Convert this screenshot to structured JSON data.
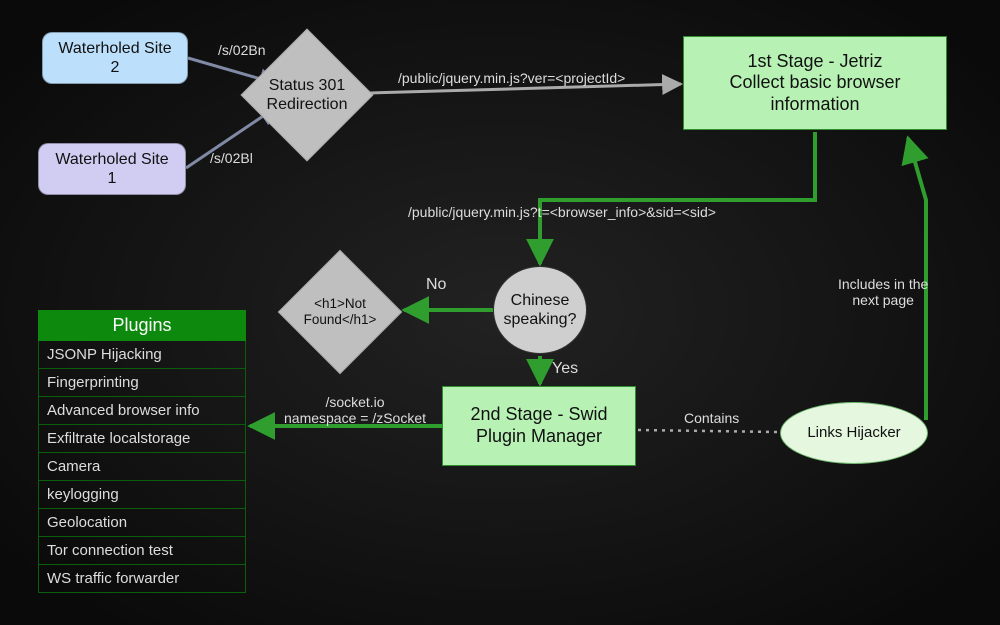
{
  "nodes": {
    "wh2": "Waterholed Site\n2",
    "wh1": "Waterholed Site\n1",
    "diamond1": "Status 301\nRedirection",
    "diamond2": "<h1>Not\nFound</h1>",
    "stage1": "1st Stage - Jetriz\nCollect basic browser\ninformation",
    "decision": "Chinese\nspeaking?",
    "stage2": "2nd Stage - Swid\nPlugin Manager",
    "ellipse": "Links Hijacker"
  },
  "plugins": {
    "header": "Plugins",
    "items": [
      "JSONP Hijacking",
      "Fingerprinting",
      "Advanced browser info",
      "Exfiltrate localstorage",
      "Camera",
      "keylogging",
      "Geolocation",
      "Tor connection test",
      "WS traffic forwarder"
    ]
  },
  "edge_labels": {
    "wh2_d1": "/s/02Bn",
    "wh1_d1": "/s/02Bl",
    "d1_s1": "/public/jquery.min.js?ver=<projectId>",
    "s1_dec": "/public/jquery.min.js?t=<browser_info>&sid=<sid>",
    "dec_no": "No",
    "dec_yes": "Yes",
    "s2_plug": "/socket.io\nnamespace = /zSocket",
    "s2_ell": "Contains",
    "ell_s1": "Includes in the\nnext page"
  }
}
